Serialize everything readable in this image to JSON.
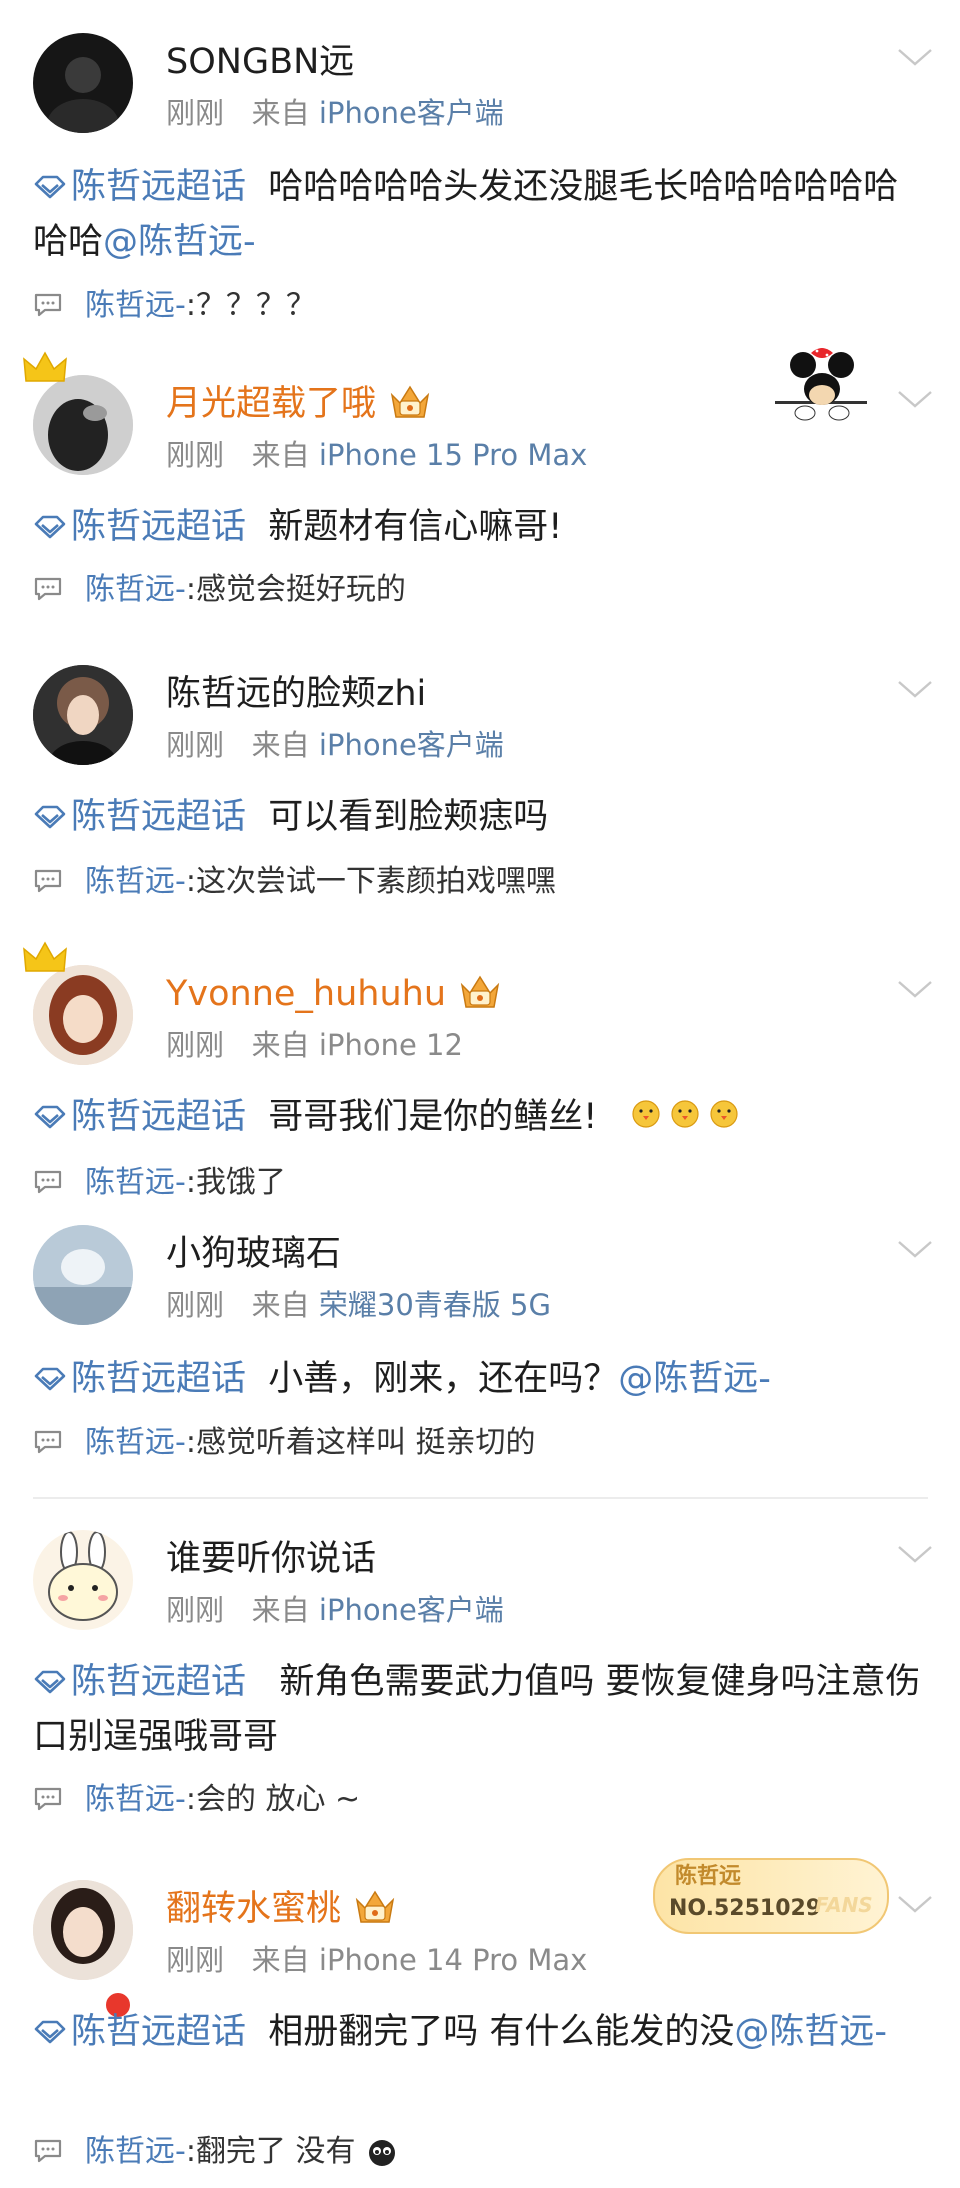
{
  "comments": [
    {
      "name": "SONGBN远",
      "time": "刚刚",
      "from": "来自",
      "device": "iPhone客户端",
      "topic": "陈哲远超话",
      "text": "哈哈哈哈哈头发还没腿毛长哈哈哈哈哈哈哈哈",
      "mention": "@陈哲远-",
      "reply_name": "陈哲远-",
      "reply_sep": ":",
      "reply_text": "？？？？"
    },
    {
      "name": "月光超载了哦",
      "time": "刚刚",
      "from": "来自",
      "device": "iPhone 15 Pro Max",
      "topic": "陈哲远超话",
      "text": "新题材有信心嘛哥!",
      "reply_name": "陈哲远-",
      "reply_sep": ":",
      "reply_text": "感觉会挺好玩的"
    },
    {
      "name": "陈哲远的脸颊zhi",
      "time": "刚刚",
      "from": "来自",
      "device": "iPhone客户端",
      "topic": "陈哲远超话",
      "text": "可以看到脸颊痣吗",
      "reply_name": "陈哲远-",
      "reply_sep": ":",
      "reply_text": "这次尝试一下素颜拍戏嘿嘿"
    },
    {
      "name": "Yvonne_huhuhu",
      "time": "刚刚",
      "from": "来自",
      "device": "iPhone 12",
      "topic": "陈哲远超话",
      "text": "哥哥我们是你的鳝丝!",
      "reply_name": "陈哲远-",
      "reply_sep": ":",
      "reply_text": "我饿了"
    },
    {
      "name": "小狗玻璃石",
      "time": "刚刚",
      "from": "来自",
      "device": "荣耀30青春版 5G",
      "topic": "陈哲远超话",
      "text": "小善，刚来，还在吗？",
      "mention": "@陈哲远-",
      "reply_name": "陈哲远-",
      "reply_sep": ":",
      "reply_text": "感觉听着这样叫 挺亲切的"
    },
    {
      "name": "谁要听你说话",
      "time": "刚刚",
      "from": "来自",
      "device": "iPhone客户端",
      "topic": "陈哲远超话",
      "text": "新角色需要武力值吗 要恢复健身吗注意伤口别逞强哦哥哥",
      "reply_name": "陈哲远-",
      "reply_sep": ":",
      "reply_text": "会的 放心 ~"
    },
    {
      "name": "翻转水蜜桃",
      "time": "刚刚",
      "from": "来自",
      "device": "iPhone 14 Pro Max",
      "topic": "陈哲远超话",
      "text": "相册翻完了吗 有什么能发的没",
      "mention": "@陈哲远-",
      "reply_name": "陈哲远-",
      "reply_sep": ":",
      "reply_text": "翻完了 没有"
    }
  ],
  "fan_badge": {
    "name": "陈哲远",
    "number": "NO.5251029",
    "word": "FANS"
  },
  "colors": {
    "link": "#4a7bb7",
    "vip_name": "#e4741b",
    "meta": "#8a8a8a"
  }
}
